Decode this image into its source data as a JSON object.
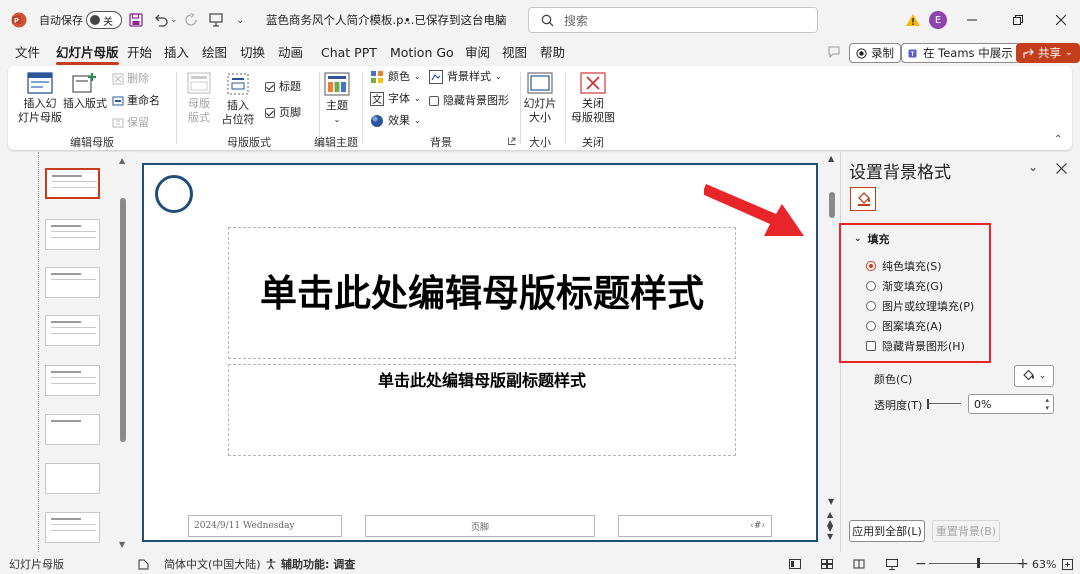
{
  "titlebar": {
    "autosave_label": "自动保存",
    "autosave_toggle": "关",
    "file_name": "蓝色商务风个人简介模板.p...",
    "save_status": "• 已保存到这台电脑",
    "search_placeholder": "搜索",
    "user_initial": "E"
  },
  "menu": {
    "tabs": [
      "文件",
      "幻灯片母版",
      "开始",
      "插入",
      "绘图",
      "切换",
      "动画",
      "Chat PPT",
      "Motion Go",
      "审阅",
      "视图",
      "帮助"
    ],
    "record": "录制",
    "teams": "在 Teams 中展示",
    "share": "共享"
  },
  "ribbon": {
    "insert_master": "插入幻\n灯片母版",
    "insert_layout": "插入版式",
    "delete": "删除",
    "rename": "重命名",
    "preserve": "保留",
    "group_edit_master": "编辑母版",
    "master_layout": "母版\n版式",
    "insert_placeholder": "插入\n占位符",
    "title_check": "标题",
    "footer_check": "页脚",
    "group_master_layout": "母版版式",
    "theme": "主题",
    "group_edit_theme": "编辑主题",
    "colors": "颜色",
    "fonts": "字体",
    "effects": "效果",
    "bg_styles": "背景样式",
    "hide_bg_graphics": "隐藏背景图形",
    "group_background": "背景",
    "slide_size": "幻灯片\n大小",
    "group_size": "大小",
    "close_master": "关闭\n母版视图",
    "group_close": "关闭"
  },
  "slide": {
    "title": "单击此处编辑母版标题样式",
    "subtitle": "单击此处编辑母版副标题样式",
    "date": "2024/9/11 Wednesday",
    "footer": "页脚",
    "number": "‹#›"
  },
  "panel": {
    "title": "设置背景格式",
    "section": "填充",
    "options": [
      "纯色填充(S)",
      "渐变填充(G)",
      "图片或纹理填充(P)",
      "图案填充(A)"
    ],
    "selected_option": "纯色填充(S)",
    "hide_bg": "隐藏背景图形(H)",
    "color_label": "颜色(C)",
    "transparency_label": "透明度(T)",
    "transparency_value": "0%",
    "apply_all": "应用到全部(L)",
    "reset_bg": "重置背景(B)"
  },
  "status": {
    "view": "幻灯片母版",
    "language": "简体中文(中国大陆)",
    "accessibility": "辅助功能: 调查",
    "zoom": "63%"
  },
  "colors": {
    "accent": "#c43e1c",
    "slide_border": "#1f4e79",
    "annotation_red": "#e8262a"
  },
  "icons": [
    "powerpoint-logo-icon",
    "save-icon",
    "undo-icon",
    "redo-icon",
    "present-icon",
    "search-icon",
    "warning-icon",
    "paint-bucket-icon",
    "close-x-icon"
  ]
}
